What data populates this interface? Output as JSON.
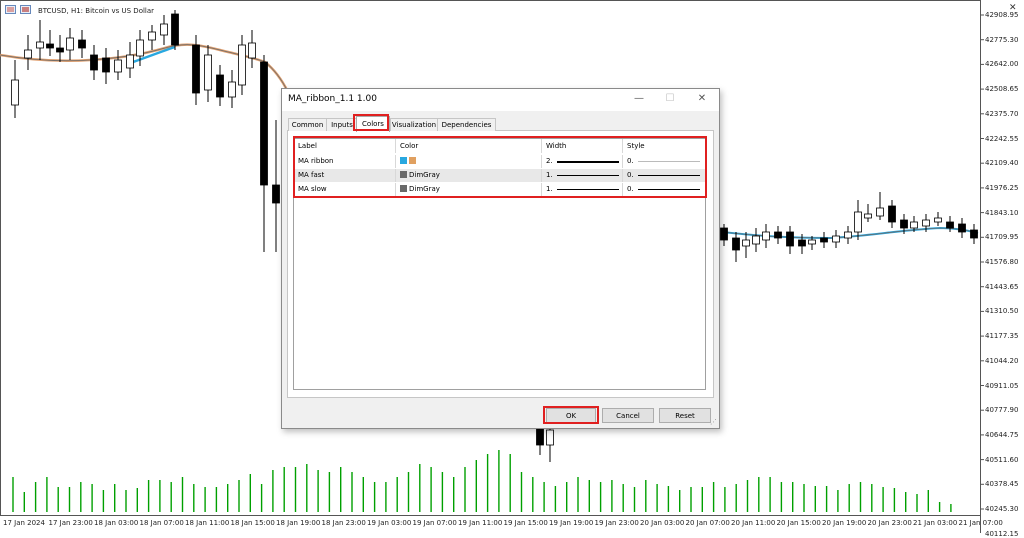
{
  "chart": {
    "symbol_label": "BTCUSD, H1: Bitcoin vs US Dollar",
    "y_ticks": [
      "42908.95",
      "42775.30",
      "42642.00",
      "42508.65",
      "42375.70",
      "42242.55",
      "42109.40",
      "41976.25",
      "41843.10",
      "41709.95",
      "41576.80",
      "41443.65",
      "41310.50",
      "41177.35",
      "41044.20",
      "40911.05",
      "40777.90",
      "40644.75",
      "40511.60",
      "40378.45",
      "40245.30",
      "40112.15"
    ],
    "x_ticks": [
      "17 Jan 2024",
      "17 Jan 23:00",
      "18 Jan 03:00",
      "18 Jan 07:00",
      "18 Jan 11:00",
      "18 Jan 15:00",
      "18 Jan 19:00",
      "18 Jan 23:00",
      "19 Jan 03:00",
      "19 Jan 07:00",
      "19 Jan 11:00",
      "19 Jan 15:00",
      "19 Jan 19:00",
      "19 Jan 23:00",
      "20 Jan 03:00",
      "20 Jan 07:00",
      "20 Jan 11:00",
      "20 Jan 15:00",
      "20 Jan 19:00",
      "20 Jan 23:00",
      "21 Jan 03:00",
      "21 Jan 07:00"
    ],
    "colors": {
      "ribbon_up": "#29a8e0",
      "ribbon_down": "#e0a070",
      "ma": "#696969",
      "volume": "#00a000"
    }
  },
  "dialog": {
    "title": "MA_ribbon_1.1 1.00",
    "tabs": [
      "Common",
      "Inputs",
      "Colors",
      "Visualization",
      "Dependencies"
    ],
    "active_tab": "Colors",
    "columns": [
      "Label",
      "Color",
      "Width",
      "Style"
    ],
    "rows": [
      {
        "label": "MA ribbon",
        "colors": [
          "#29a8e0",
          "#e0a060"
        ],
        "color_name": "",
        "width": "2.",
        "style": "0."
      },
      {
        "label": "MA fast",
        "colors": [
          "#696969"
        ],
        "color_name": "DimGray",
        "width": "1.",
        "style": "0."
      },
      {
        "label": "MA slow",
        "colors": [
          "#696969"
        ],
        "color_name": "DimGray",
        "width": "1.",
        "style": "0."
      }
    ],
    "buttons": {
      "ok": "OK",
      "cancel": "Cancel",
      "reset": "Reset"
    }
  }
}
